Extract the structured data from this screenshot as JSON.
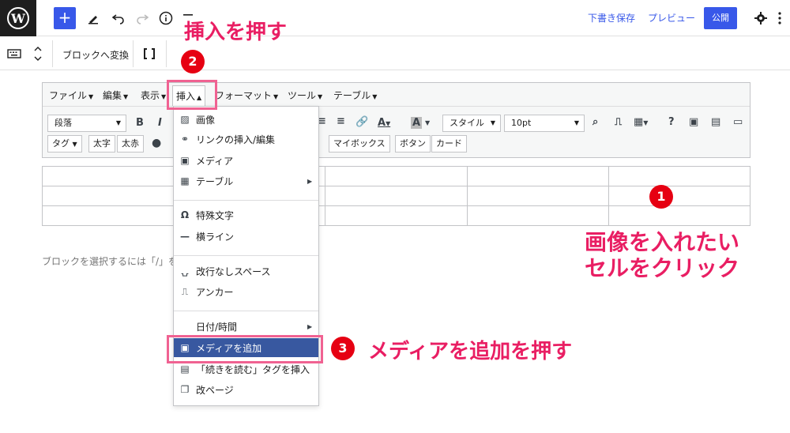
{
  "topbar": {
    "save_draft": "下書き保存",
    "preview": "プレビュー",
    "publish": "公開"
  },
  "blockbar": {
    "convert": "ブロックへ変換"
  },
  "classic": {
    "menus": [
      {
        "label": "ファイル"
      },
      {
        "label": "編集"
      },
      {
        "label": "表示"
      },
      {
        "label": "挿入"
      },
      {
        "label": "フォーマット"
      },
      {
        "label": "ツール"
      },
      {
        "label": "テーブル"
      }
    ],
    "format_select": "段落",
    "style_select": "スタイル",
    "size_select": "10pt",
    "row2_buttons": [
      "タグ",
      "太字",
      "太赤",
      "マイボックス",
      "ボタン",
      "カード"
    ]
  },
  "placeholder": "ブロックを選択するには「/」を",
  "dropdown": {
    "items": [
      {
        "label": "画像",
        "icon": "image-icon"
      },
      {
        "label": "リンクの挿入/編集",
        "icon": "link-icon"
      },
      {
        "label": "メディア",
        "icon": "media-icon"
      },
      {
        "label": "テーブル",
        "icon": "table-icon",
        "submenu": true
      },
      {
        "label": "特殊文字",
        "icon": "omega-icon"
      },
      {
        "label": "横ライン",
        "icon": "hr-icon"
      },
      {
        "label": "改行なしスペース",
        "icon": "nbsp-icon"
      },
      {
        "label": "アンカー",
        "icon": "bookmark-icon"
      },
      {
        "label": "日付/時間",
        "icon": "",
        "submenu": true
      },
      {
        "label": "メディアを追加",
        "icon": "add-media-icon",
        "highlighted": true
      },
      {
        "label": "「続きを読む」タグを挿入",
        "icon": "more-tag-icon"
      },
      {
        "label": "改ページ",
        "icon": "pagebreak-icon"
      }
    ]
  },
  "annotations": {
    "step1_badge": "1",
    "step1_text_line1": "画像を入れたい",
    "step1_text_line2": "セルをクリック",
    "step2_badge": "2",
    "step2_text": "挿入を押す",
    "step3_badge": "3",
    "step3_text": "メディアを追加を押す"
  },
  "colors": {
    "accent": "#3858e9",
    "annotation_pink": "#e91e63",
    "badge_red": "#e60012",
    "highlight": "#3858a0"
  }
}
